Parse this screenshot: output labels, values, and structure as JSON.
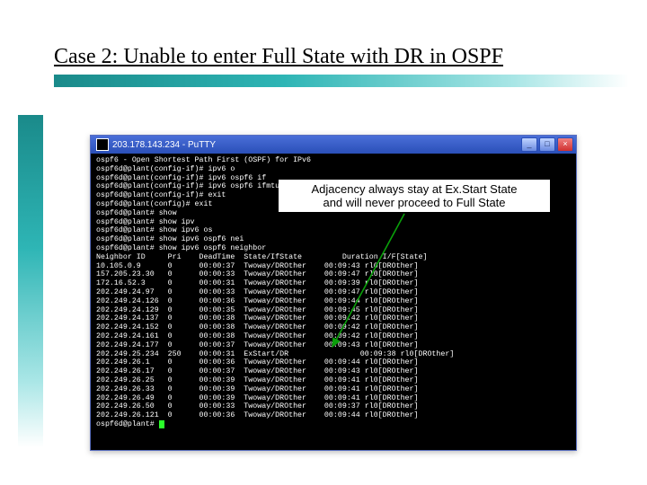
{
  "slide": {
    "title": "Case 2: Unable to enter Full State with DR in OSPF"
  },
  "callout": {
    "line1": "Adjacency always stay at Ex.Start State",
    "line2": "and will never proceed to Full State"
  },
  "terminal": {
    "window_title": "203.178.143.234 - PuTTY",
    "btn_min": "_",
    "btn_max": "□",
    "btn_close": "×",
    "pre_lines": [
      "ospf6 - Open Shortest Path First (OSPF) for IPv6",
      "ospf6d@plant(config-if)# ipv6 o",
      "ospf6d@plant(config-if)# ipv6 ospf6 if",
      "ospf6d@plant(config-if)# ipv6 ospf6 ifmtu 1500",
      "ospf6d@plant(config-if)# exit",
      "ospf6d@plant(config)# exit",
      "ospf6d@plant# show",
      "ospf6d@plant# show ipv",
      "ospf6d@plant# show ipv6 os",
      "ospf6d@plant# show ipv6 ospf6 nei",
      "ospf6d@plant# show ipv6 ospf6 neighbor"
    ],
    "header": "Neighbor ID     Pri    DeadTime  State/IfState         Duration I/F[State]",
    "rows": [
      {
        "id": "10.105.0.9",
        "pri": "0",
        "dead": "00:00:37",
        "state": "Twoway/DROther",
        "dur": "00:09:43",
        "if": "rl0[DROther]"
      },
      {
        "id": "157.205.23.30",
        "pri": "0",
        "dead": "00:00:33",
        "state": "Twoway/DROther",
        "dur": "00:09:47",
        "if": "rl0[DROther]"
      },
      {
        "id": "172.16.52.3",
        "pri": "0",
        "dead": "00:00:31",
        "state": "Twoway/DROther",
        "dur": "00:09:39",
        "if": "rl0[DROther]"
      },
      {
        "id": "202.249.24.97",
        "pri": "0",
        "dead": "00:00:33",
        "state": "Twoway/DROther",
        "dur": "00:09:47",
        "if": "rl0[DROther]"
      },
      {
        "id": "202.249.24.126",
        "pri": "0",
        "dead": "00:00:36",
        "state": "Twoway/DROther",
        "dur": "00:09:44",
        "if": "rl0[DROther]"
      },
      {
        "id": "202.249.24.129",
        "pri": "0",
        "dead": "00:00:35",
        "state": "Twoway/DROther",
        "dur": "00:09:45",
        "if": "rl0[DROther]"
      },
      {
        "id": "202.249.24.137",
        "pri": "0",
        "dead": "00:00:38",
        "state": "Twoway/DROther",
        "dur": "00:09:42",
        "if": "rl0[DROther]"
      },
      {
        "id": "202.249.24.152",
        "pri": "0",
        "dead": "00:00:38",
        "state": "Twoway/DROther",
        "dur": "00:09:42",
        "if": "rl0[DROther]"
      },
      {
        "id": "202.249.24.161",
        "pri": "0",
        "dead": "00:00:38",
        "state": "Twoway/DROther",
        "dur": "00:09:42",
        "if": "rl0[DROther]"
      },
      {
        "id": "202.249.24.177",
        "pri": "0",
        "dead": "00:00:37",
        "state": "Twoway/DROther",
        "dur": "00:09:43",
        "if": "rl0[DROther]"
      },
      {
        "id": "202.249.25.234",
        "pri": "250",
        "dead": "00:00:31",
        "state": "ExStart/DR",
        "dur": "00:09:38",
        "if": "rl0[DROther]",
        "wide_dur": true
      },
      {
        "id": "202.249.26.1",
        "pri": "0",
        "dead": "00:00:36",
        "state": "Twoway/DROther",
        "dur": "00:09:44",
        "if": "rl0[DROther]"
      },
      {
        "id": "202.249.26.17",
        "pri": "0",
        "dead": "00:00:37",
        "state": "Twoway/DROther",
        "dur": "00:09:43",
        "if": "rl0[DROther]"
      },
      {
        "id": "202.249.26.25",
        "pri": "0",
        "dead": "00:00:39",
        "state": "Twoway/DROther",
        "dur": "00:09:41",
        "if": "rl0[DROther]"
      },
      {
        "id": "202.249.26.33",
        "pri": "0",
        "dead": "00:00:39",
        "state": "Twoway/DROther",
        "dur": "00:09:41",
        "if": "rl0[DROther]"
      },
      {
        "id": "202.249.26.49",
        "pri": "0",
        "dead": "00:00:39",
        "state": "Twoway/DROther",
        "dur": "00:09:41",
        "if": "rl0[DROther]"
      },
      {
        "id": "202.249.26.50",
        "pri": "0",
        "dead": "00:00:33",
        "state": "Twoway/DROther",
        "dur": "00:09:37",
        "if": "rl0[DROther]"
      },
      {
        "id": "202.249.26.121",
        "pri": "0",
        "dead": "00:00:36",
        "state": "Twoway/DROther",
        "dur": "00:09:44",
        "if": "rl0[DROther]"
      }
    ],
    "prompt": "ospf6d@plant# "
  }
}
